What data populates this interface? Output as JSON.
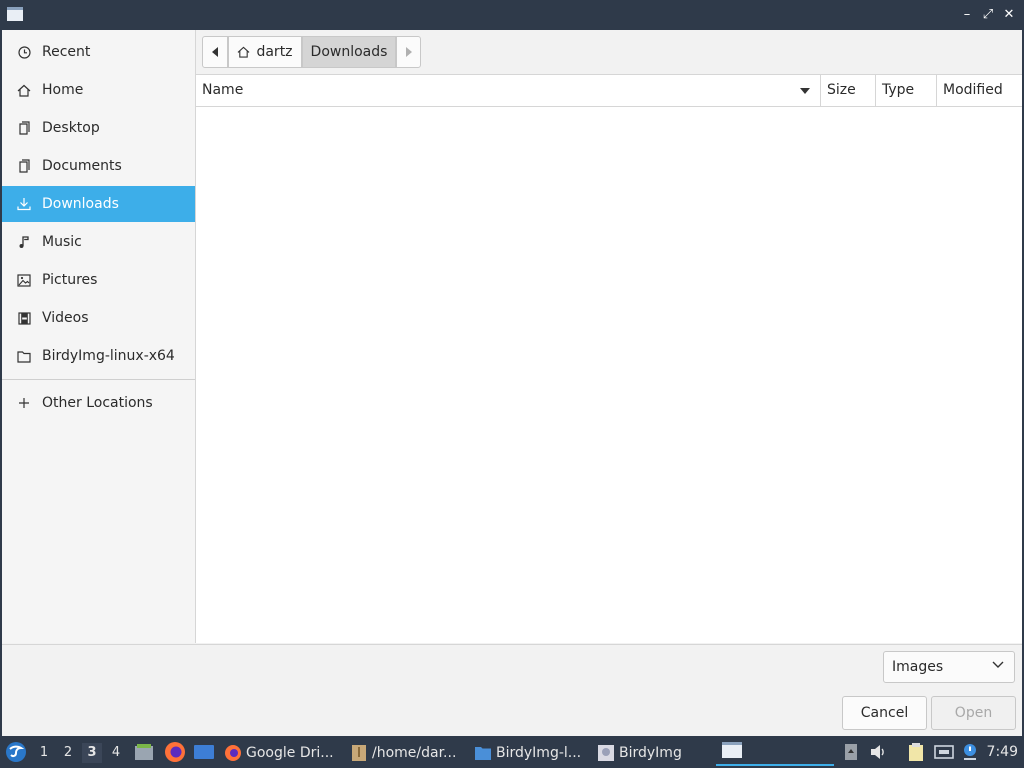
{
  "sidebar": {
    "items": [
      {
        "label": "Recent",
        "icon": "clock-icon"
      },
      {
        "label": "Home",
        "icon": "home-icon"
      },
      {
        "label": "Desktop",
        "icon": "desktop-icon"
      },
      {
        "label": "Documents",
        "icon": "documents-icon"
      },
      {
        "label": "Downloads",
        "icon": "download-icon"
      },
      {
        "label": "Music",
        "icon": "music-icon"
      },
      {
        "label": "Pictures",
        "icon": "pictures-icon"
      },
      {
        "label": "Videos",
        "icon": "videos-icon"
      },
      {
        "label": "BirdyImg-linux-x64",
        "icon": "folder-icon"
      }
    ],
    "other_locations": "Other Locations",
    "active_index": 4
  },
  "pathbar": {
    "segments": [
      "dartz",
      "Downloads"
    ]
  },
  "columns": {
    "name": "Name",
    "size": "Size",
    "type": "Type",
    "modified": "Modified"
  },
  "filter": {
    "selected": "Images"
  },
  "buttons": {
    "cancel": "Cancel",
    "open": "Open"
  },
  "taskbar": {
    "workspaces": [
      "1",
      "2",
      "3",
      "4"
    ],
    "current_workspace": "3",
    "tasks": [
      {
        "label": "Google Dri..."
      },
      {
        "label": "/home/dar..."
      },
      {
        "label": "BirdyImg-l..."
      },
      {
        "label": "BirdyImg"
      }
    ],
    "clock": "7:49"
  },
  "colors": {
    "accent": "#3daee9",
    "titlebar": "#2f3a4a",
    "panel": "#2f3a4a"
  }
}
